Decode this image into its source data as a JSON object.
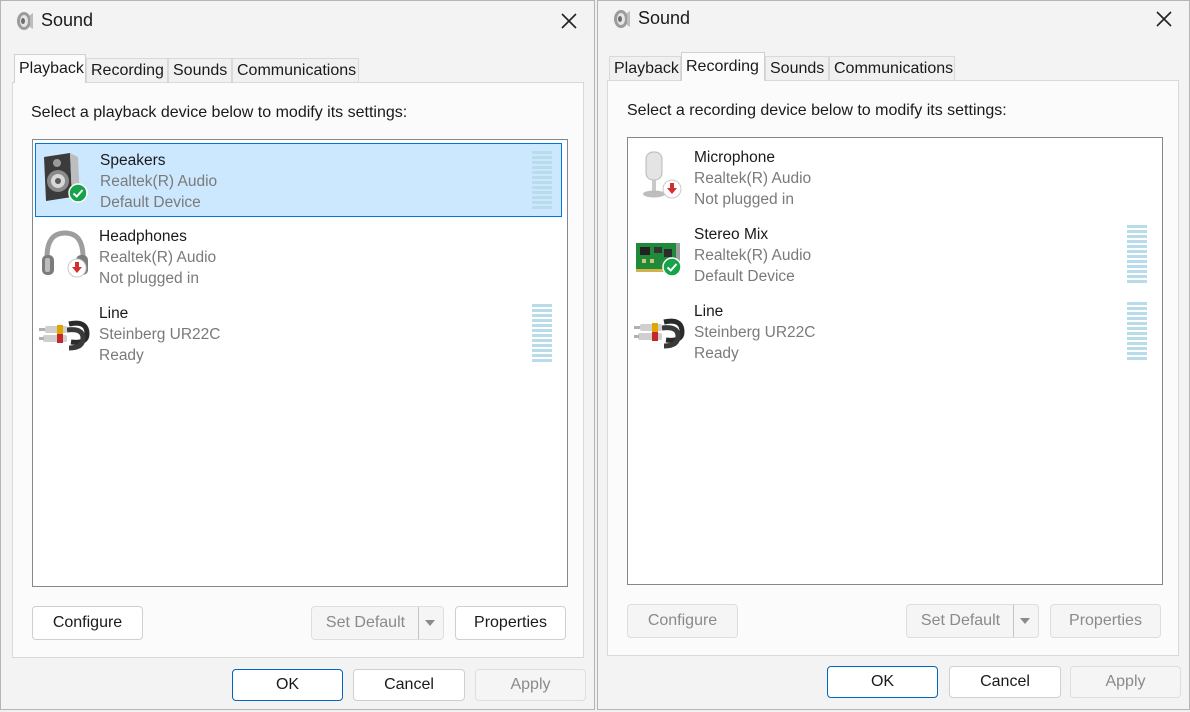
{
  "windows": {
    "left": {
      "title": "Sound",
      "tabs": [
        "Playback",
        "Recording",
        "Sounds",
        "Communications"
      ],
      "active_tab": "Playback",
      "instruction": "Select a playback device below to modify its settings:",
      "devices": [
        {
          "name": "Speakers",
          "driver": "Realtek(R) Audio",
          "status": "Default Device",
          "icon": "speaker-icon",
          "badge": "check-badge-icon",
          "selected": true,
          "meter": true
        },
        {
          "name": "Headphones",
          "driver": "Realtek(R) Audio",
          "status": "Not plugged in",
          "icon": "headphones-icon",
          "badge": "unplugged-badge-icon",
          "selected": false,
          "meter": false
        },
        {
          "name": "Line",
          "driver": "Steinberg UR22C",
          "status": "Ready",
          "icon": "rca-cable-icon",
          "badge": "",
          "selected": false,
          "meter": true
        }
      ],
      "buttons": {
        "configure": "Configure",
        "set_default": "Set Default",
        "properties": "Properties",
        "ok": "OK",
        "cancel": "Cancel",
        "apply": "Apply"
      }
    },
    "right": {
      "title": "Sound",
      "tabs": [
        "Playback",
        "Recording",
        "Sounds",
        "Communications"
      ],
      "active_tab": "Recording",
      "instruction": "Select a recording device below to modify its settings:",
      "devices": [
        {
          "name": "Microphone",
          "driver": "Realtek(R) Audio",
          "status": "Not plugged in",
          "icon": "microphone-icon",
          "badge": "unplugged-badge-icon",
          "selected": false,
          "meter": false
        },
        {
          "name": "Stereo Mix",
          "driver": "Realtek(R) Audio",
          "status": "Default Device",
          "icon": "sound-card-icon",
          "badge": "check-badge-icon",
          "selected": false,
          "meter": true
        },
        {
          "name": "Line",
          "driver": "Steinberg UR22C",
          "status": "Ready",
          "icon": "rca-cable-icon",
          "badge": "",
          "selected": false,
          "meter": true
        }
      ],
      "buttons": {
        "configure": "Configure",
        "set_default": "Set Default",
        "properties": "Properties",
        "ok": "OK",
        "cancel": "Cancel",
        "apply": "Apply"
      }
    }
  },
  "colors": {
    "selection_bg": "#cce8ff",
    "selection_border": "#0078d7",
    "meter": "#b9dcea",
    "default_badge": "#16a34a",
    "unplugged_badge": "#d32f2f"
  }
}
